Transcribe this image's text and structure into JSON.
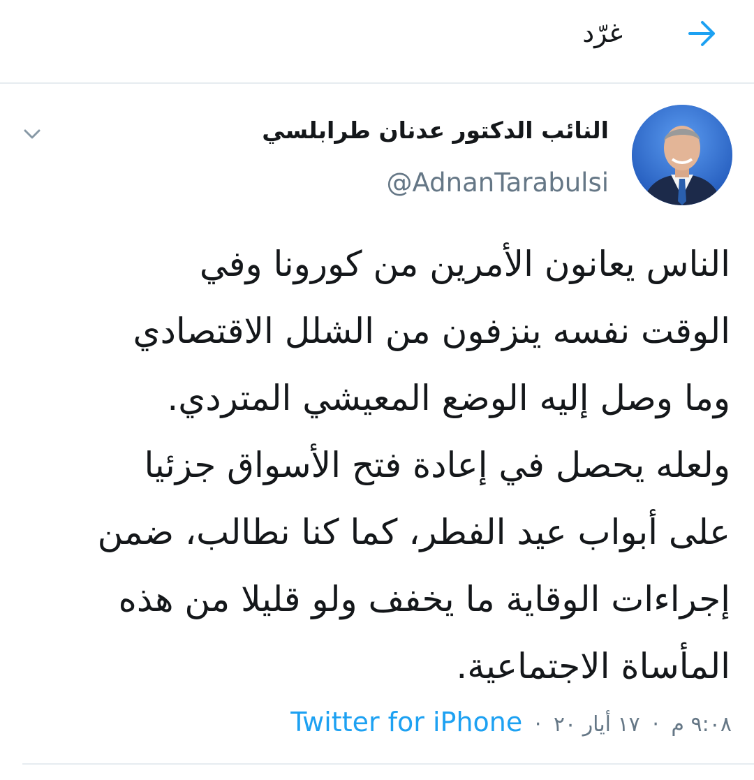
{
  "header": {
    "title": "غرّد",
    "back_icon": "arrow-right-icon",
    "accent": "#1da1f2"
  },
  "tweet": {
    "display_name": "النائب الدكتور عدنان طرابلسي",
    "handle": "@AdnanTarabulsi",
    "menu_icon": "chevron-down-icon",
    "lines": [
      "الناس يعانون الأمرين من كورونا وفي",
      "الوقت نفسه ينزفون من الشلل الاقتصادي",
      "وما وصل إليه الوضع المعيشي المتردي.",
      "ولعله يحصل في إعادة فتح الأسواق جزئيا",
      "على أبواب عيد الفطر، كما كنا نطالب، ضمن",
      "إجراءات الوقاية ما يخفف ولو قليلا من هذه",
      "المأساة الاجتماعية."
    ],
    "time": "٩:٠٨ م",
    "date": "١٧ أيار ٢٠",
    "separator": "·",
    "source": "Twitter for iPhone"
  },
  "colors": {
    "text": "#14171a",
    "secondary": "#657786",
    "link": "#1da1f2",
    "divider": "#e6ecf0"
  }
}
